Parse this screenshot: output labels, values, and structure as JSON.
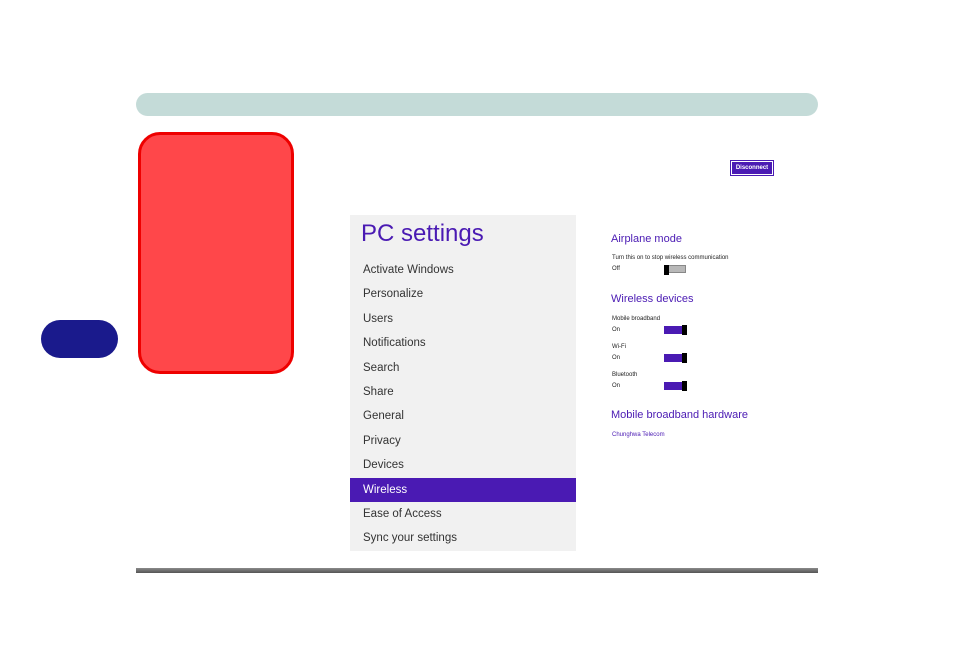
{
  "colors": {
    "accent": "#4a1ab3",
    "header_bar": "#c4dbd8",
    "callout_red": "#ff474a",
    "chapter_tab": "#1a1a8c"
  },
  "toolbar": {
    "disconnect_label": "Disconnect"
  },
  "settings": {
    "title": "PC settings",
    "nav": [
      {
        "label": "Activate Windows"
      },
      {
        "label": "Personalize"
      },
      {
        "label": "Users"
      },
      {
        "label": "Notifications"
      },
      {
        "label": "Search"
      },
      {
        "label": "Share"
      },
      {
        "label": "General"
      },
      {
        "label": "Privacy"
      },
      {
        "label": "Devices"
      },
      {
        "label": "Wireless",
        "selected": true
      },
      {
        "label": "Ease of Access"
      },
      {
        "label": "Sync your settings"
      }
    ]
  },
  "wireless": {
    "airplane": {
      "heading": "Airplane mode",
      "description": "Turn this on to stop wireless communication",
      "state": "Off"
    },
    "devices": {
      "heading": "Wireless devices",
      "items": [
        {
          "label": "Mobile broadband",
          "state": "On"
        },
        {
          "label": "Wi-Fi",
          "state": "On"
        },
        {
          "label": "Bluetooth",
          "state": "On"
        }
      ]
    },
    "hardware": {
      "heading": "Mobile broadband hardware",
      "provider": "Chunghwa Telecom"
    }
  }
}
